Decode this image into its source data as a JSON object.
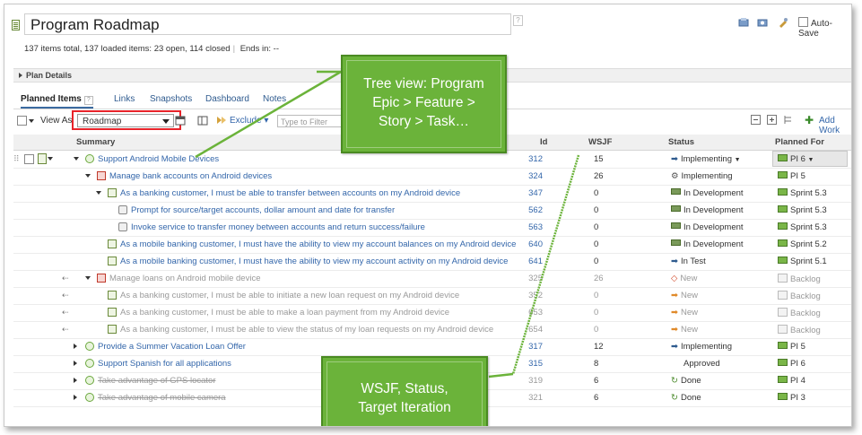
{
  "app": {
    "title": "Program Roadmap",
    "help": "?",
    "summary": {
      "items_total": "137 items total, 137 loaded items:",
      "open_closed": "23 open, 114 closed",
      "ends_in": "Ends in: --"
    },
    "autosave_label": "Auto-Save",
    "plan_details": "Plan Details"
  },
  "tabs": [
    {
      "label": "Planned Items",
      "active": true
    },
    {
      "label": "Links"
    },
    {
      "label": "Snapshots"
    },
    {
      "label": "Dashboard"
    },
    {
      "label": "Notes"
    }
  ],
  "toolbar": {
    "view_as_label": "View As",
    "view_value": "Roadmap",
    "exclude_label": "Exclude",
    "filter_placeholder": "Type to Filter",
    "add_work_label": "Add Work"
  },
  "columns": [
    "Summary",
    "Id",
    "WSJF",
    "Status",
    "Planned For"
  ],
  "rows": [
    {
      "summary": "Support Android Mobile Devices",
      "id": "312",
      "wsjf": "15",
      "status": "Implementing",
      "planned": "PI 6",
      "type": "epic",
      "level": 0,
      "expanded": true,
      "style": "normal",
      "status_icon": "arrow",
      "plan_icon": "iteration",
      "selected": true
    },
    {
      "summary": "Manage bank accounts on Android devices",
      "id": "324",
      "wsjf": "26",
      "status": "Implementing",
      "planned": "PI 5",
      "type": "feature",
      "level": 1,
      "expanded": true,
      "style": "normal",
      "status_icon": "gear",
      "plan_icon": "iteration"
    },
    {
      "summary": "As a banking customer, I must be able to transfer between accounts on my Android device",
      "id": "347",
      "wsjf": "0",
      "status": "In Development",
      "planned": "Sprint 5.3",
      "type": "story",
      "level": 2,
      "expanded": true,
      "style": "normal",
      "status_icon": "bar",
      "plan_icon": "iteration"
    },
    {
      "summary": "Prompt for source/target accounts, dollar amount and date for transfer",
      "id": "562",
      "wsjf": "0",
      "status": "In Development",
      "planned": "Sprint 5.3",
      "type": "task",
      "level": 3,
      "style": "normal",
      "status_icon": "bar",
      "plan_icon": "iteration"
    },
    {
      "summary": "Invoke service to transfer money between accounts and return success/failure",
      "id": "563",
      "wsjf": "0",
      "status": "In Development",
      "planned": "Sprint 5.3",
      "type": "task",
      "level": 3,
      "style": "normal",
      "status_icon": "bar",
      "plan_icon": "iteration"
    },
    {
      "summary": "As a mobile banking customer, I must have the ability to view my account balances on my Android device",
      "id": "640",
      "wsjf": "0",
      "status": "In Development",
      "planned": "Sprint 5.2",
      "type": "story",
      "level": 2,
      "style": "normal",
      "status_icon": "bar",
      "plan_icon": "iteration"
    },
    {
      "summary": "As a mobile banking customer, I must have the ability to view my account activity on my Android device",
      "id": "641",
      "wsjf": "0",
      "status": "In Test",
      "planned": "Sprint 5.1",
      "type": "story",
      "level": 2,
      "style": "normal",
      "status_icon": "arrow",
      "plan_icon": "iteration"
    },
    {
      "summary": "Manage loans on Android mobile device",
      "id": "325",
      "wsjf": "26",
      "status": "New",
      "planned": "Backlog",
      "type": "feature",
      "level": 1,
      "expanded": true,
      "style": "grey",
      "status_icon": "diamond",
      "plan_icon": "backlog",
      "outdent": true
    },
    {
      "summary": "As a banking customer, I must be able to initiate a new loan request on my Android device",
      "id": "352",
      "wsjf": "0",
      "status": "New",
      "planned": "Backlog",
      "type": "story",
      "level": 2,
      "style": "grey",
      "status_icon": "orange-arrow",
      "plan_icon": "backlog",
      "outdent": true
    },
    {
      "summary": "As a banking customer, I must be able to make a loan payment from my Android device",
      "id": "653",
      "wsjf": "0",
      "status": "New",
      "planned": "Backlog",
      "type": "story",
      "level": 2,
      "style": "grey",
      "status_icon": "orange-arrow",
      "plan_icon": "backlog",
      "outdent": true
    },
    {
      "summary": "As a banking customer, I must be able to view the status of my loan requests on my Android device",
      "id": "654",
      "wsjf": "0",
      "status": "New",
      "planned": "Backlog",
      "type": "story",
      "level": 2,
      "style": "grey",
      "status_icon": "orange-arrow",
      "plan_icon": "backlog",
      "outdent": true
    },
    {
      "summary": "Provide a Summer Vacation Loan Offer",
      "id": "317",
      "wsjf": "12",
      "status": "Implementing",
      "planned": "PI 5",
      "type": "epic",
      "level": 0,
      "expanded": false,
      "style": "normal",
      "status_icon": "arrow",
      "plan_icon": "iteration"
    },
    {
      "summary": "Support Spanish for all applications",
      "id": "315",
      "wsjf": "8",
      "status": "Approved",
      "planned": "PI 6",
      "type": "epic",
      "level": 0,
      "expanded": false,
      "style": "normal",
      "status_icon": "none",
      "plan_icon": "iteration"
    },
    {
      "summary": "Take advantage of GPS locator",
      "id": "319",
      "wsjf": "6",
      "status": "Done",
      "planned": "PI 4",
      "type": "epic",
      "level": 0,
      "expanded": false,
      "style": "done",
      "status_icon": "check",
      "plan_icon": "iteration"
    },
    {
      "summary": "Take advantage of mobile camera",
      "id": "321",
      "wsjf": "6",
      "status": "Done",
      "planned": "PI 3",
      "type": "epic",
      "level": 0,
      "expanded": false,
      "style": "done",
      "status_icon": "check",
      "plan_icon": "iteration"
    }
  ],
  "callouts": {
    "tree": [
      "Tree view: Program",
      "Epic > Feature >",
      "Story > Task…"
    ],
    "wsjf": [
      "WSJF, Status,",
      "Target Iteration"
    ]
  },
  "colors": {
    "link": "#3366aa",
    "callout_green": "#6bb33a",
    "highlight_red": "#e8232a"
  }
}
